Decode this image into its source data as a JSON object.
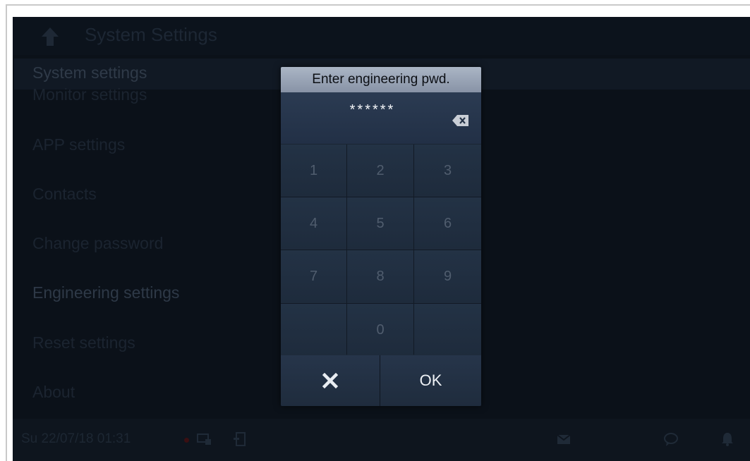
{
  "header": {
    "title": "System Settings",
    "back_icon": "back-arrow-icon"
  },
  "menu": {
    "items": [
      {
        "label": "System settings"
      },
      {
        "label": "Monitor settings"
      },
      {
        "label": "APP settings"
      },
      {
        "label": "Contacts"
      },
      {
        "label": "Change password"
      },
      {
        "label": "Engineering settings"
      },
      {
        "label": "Reset settings"
      },
      {
        "label": "About"
      }
    ]
  },
  "status": {
    "datetime": "Su 22/07/18   01:31",
    "icons": [
      "alarm-dot-icon",
      "monitor-icon",
      "door-icon",
      "message-icon",
      "chat-icon",
      "bell-icon"
    ]
  },
  "dialog": {
    "title": "Enter engineering pwd.",
    "password_value": "******",
    "keys": [
      "1",
      "2",
      "3",
      "4",
      "5",
      "6",
      "7",
      "8",
      "9",
      "",
      "0",
      ""
    ],
    "ok_label": "OK",
    "cancel_icon": "close-icon",
    "backspace_icon": "backspace-icon"
  },
  "colors": {
    "screen_background": "#0b1119",
    "dialog_title_bg": "#9aa5b6",
    "dialog_body": "#1c2735",
    "status_dot": "#3a0f12"
  }
}
